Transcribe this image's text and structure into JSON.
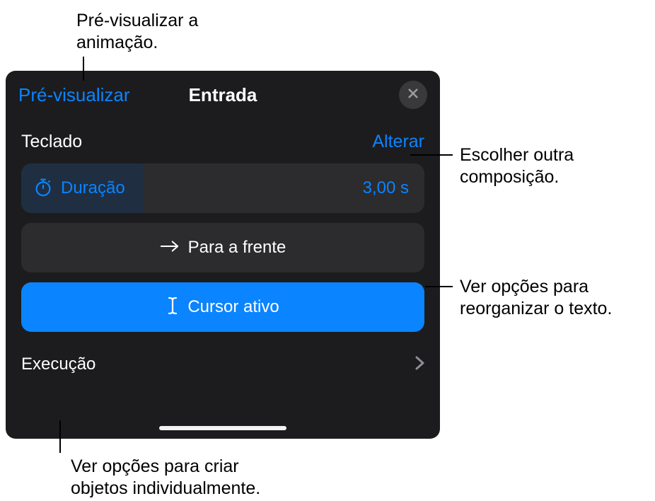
{
  "callouts": {
    "preview": "Pré-visualizar a\nanimação.",
    "alter": "Escolher outra composição.",
    "direction": "Ver opções para reorganizar o texto.",
    "exec": "Ver opções para criar objetos individualmente."
  },
  "panel": {
    "preview_label": "Pré-visualizar",
    "title": "Entrada",
    "section_label": "Teclado",
    "alter_label": "Alterar",
    "duration_label": "Duração",
    "duration_value": "3,00 s",
    "direction_label": "Para a frente",
    "cursor_label": "Cursor ativo",
    "exec_label": "Execução"
  },
  "colors": {
    "accent": "#0a84ff",
    "panel_bg": "#1c1c1e",
    "row_bg": "#2c2c2e"
  }
}
